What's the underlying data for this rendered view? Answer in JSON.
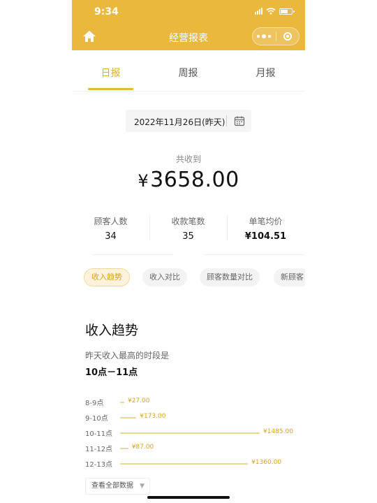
{
  "status_bar": {
    "time": "9:34"
  },
  "navbar": {
    "title": "经营报表"
  },
  "tabs": [
    {
      "label": "日报",
      "active": true
    },
    {
      "label": "周报",
      "active": false
    },
    {
      "label": "月报",
      "active": false
    }
  ],
  "date_picker": {
    "value": "2022年11月26日(昨天)"
  },
  "summary": {
    "label": "共收到",
    "currency": "¥",
    "amount": "3658.00"
  },
  "stats": [
    {
      "label": "顾客人数",
      "value": "34"
    },
    {
      "label": "收款笔数",
      "value": "35"
    },
    {
      "label": "单笔均价",
      "value": "¥104.51"
    }
  ],
  "filter_chips": [
    {
      "label": "收入趋势",
      "active": true
    },
    {
      "label": "收入对比",
      "active": false
    },
    {
      "label": "顾客数量对比",
      "active": false
    },
    {
      "label": "新顾客",
      "active": false
    }
  ],
  "trend": {
    "title": "收入趋势",
    "peak_label": "昨天收入最高的时段是",
    "peak_value": "10点－11点"
  },
  "chart_data": {
    "type": "bar",
    "orientation": "horizontal",
    "categories": [
      "8-9点",
      "9-10点",
      "10-11点",
      "11-12点",
      "12-13点"
    ],
    "values": [
      27.0,
      173.0,
      1485.0,
      87.0,
      1360.0
    ],
    "value_labels": [
      "¥27.00",
      "¥173.00",
      "¥1485.00",
      "¥87.00",
      "¥1360.00"
    ],
    "bar_color": "#eed699",
    "label_color": "#d9a21b"
  },
  "view_all": {
    "label": "查看全部数据"
  },
  "colors": {
    "accent": "#e9b83d",
    "accent_text": "#e3ae24"
  }
}
